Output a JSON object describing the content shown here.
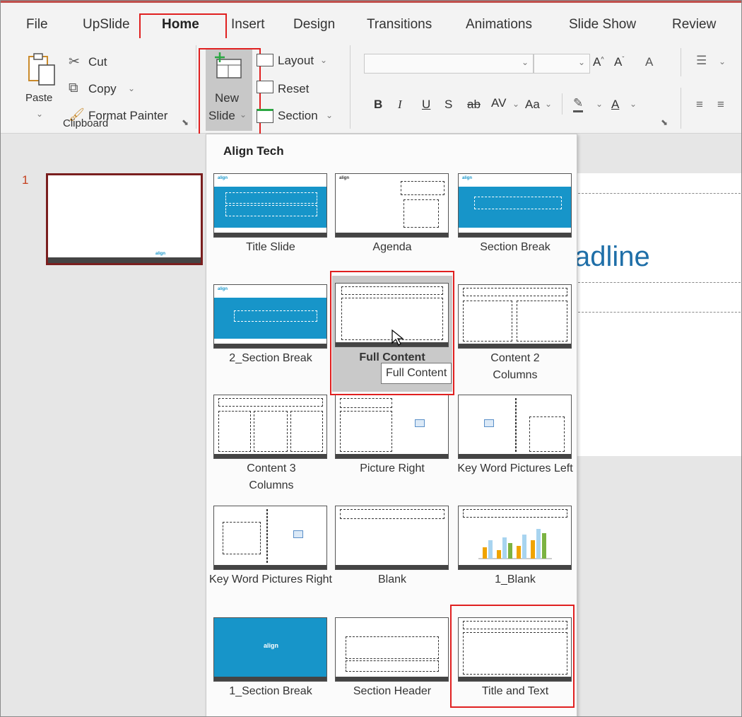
{
  "colors": {
    "accent": "#c43e1c",
    "highlight_box": "#e02020",
    "theme_blue": "#1795c9",
    "headline": "#1f6fa8"
  },
  "tabs": [
    "File",
    "UpSlide",
    "Home",
    "Insert",
    "Design",
    "Transitions",
    "Animations",
    "Slide Show",
    "Review"
  ],
  "active_tab": "Home",
  "clipboard": {
    "paste": "Paste",
    "cut": "Cut",
    "copy": "Copy",
    "format_painter": "Format Painter",
    "group_label": "Clipboard"
  },
  "slides": {
    "new_slide_1": "New",
    "new_slide_2": "Slide",
    "layout": "Layout",
    "reset": "Reset",
    "section": "Section"
  },
  "font": {
    "bold": "B",
    "italic": "I",
    "underline": "U",
    "shadow": "S",
    "strike": "ab",
    "spacing": "AV",
    "case": "Aa",
    "color": "A"
  },
  "icons": {
    "cut": "scissors-icon",
    "copy": "copy-icon",
    "paste": "clipboard-paste-icon",
    "format_painter": "paintbrush-icon",
    "new_slide": "new-slide-icon",
    "layout": "layout-icon",
    "reset": "reset-icon",
    "section": "section-icon",
    "cursor": "mouse-pointer-icon"
  },
  "slide_panel": {
    "number": "1"
  },
  "slide_headline": "adline",
  "gallery": {
    "title": "Align Tech",
    "layouts": [
      "Title Slide",
      "Agenda",
      "Section Break",
      "2_Section Break",
      "Full Content",
      "Content 2 Columns",
      "Content 3 Columns",
      "Picture Right",
      "Key Word Pictures Left",
      "Key Word Pictures Right",
      "Blank",
      "1_Blank",
      "1_Section Break",
      "Section Header",
      "Title and Text"
    ],
    "hovered": "Full Content",
    "tooltip": "Full Content",
    "thumb_logo": "align",
    "thumb_logo_blue": "align"
  }
}
